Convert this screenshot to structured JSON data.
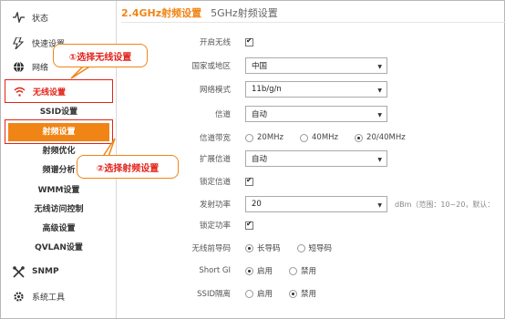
{
  "colors": {
    "accent": "#f08516",
    "highlight": "#e2231a"
  },
  "sidebar": {
    "items": [
      {
        "label": "状态",
        "icon": "pulse-icon"
      },
      {
        "label": "快速设置",
        "icon": "lightning-icon"
      },
      {
        "label": "网络",
        "icon": "globe-icon"
      },
      {
        "label": "无线设置",
        "icon": "wifi-icon",
        "active": true
      }
    ],
    "subitems": [
      {
        "label": "SSID设置"
      },
      {
        "label": "射频设置",
        "active": true
      },
      {
        "label": "射频优化"
      },
      {
        "label": "频谱分析"
      },
      {
        "label": "WMM设置"
      },
      {
        "label": "无线访问控制"
      },
      {
        "label": "高级设置"
      },
      {
        "label": "QVLAN设置"
      }
    ],
    "bottom": [
      {
        "label": "SNMP",
        "icon": "tools-icon"
      },
      {
        "label": "系统工具",
        "icon": "gear-icon"
      }
    ]
  },
  "tabs": [
    {
      "label": "2.4GHz射频设置"
    },
    {
      "label": "5GHz射频设置"
    }
  ],
  "form": {
    "enable_wireless": {
      "label": "开启无线",
      "checked": true
    },
    "country": {
      "label": "国家或地区",
      "value": "中国"
    },
    "network_mode": {
      "label": "网络模式",
      "value": "11b/g/n"
    },
    "channel": {
      "label": "信道",
      "value": "自动"
    },
    "bandwidth": {
      "label": "信道带宽",
      "options": [
        "20MHz",
        "40MHz",
        "20/40MHz"
      ],
      "selected": "20/40MHz"
    },
    "ext_channel": {
      "label": "扩展信道",
      "value": "自动"
    },
    "lock_channel": {
      "label": "锁定信道",
      "checked": true
    },
    "tx_power": {
      "label": "发射功率",
      "value": "20",
      "hint": "dBm（范围：10~20，默认："
    },
    "lock_power": {
      "label": "锁定功率",
      "checked": true
    },
    "preamble": {
      "label": "无线前导码",
      "options": [
        "长导码",
        "短导码"
      ],
      "selected": "长导码"
    },
    "short_gi": {
      "label": "Short GI",
      "options": [
        "启用",
        "禁用"
      ],
      "selected": "启用"
    },
    "ssid_isolation": {
      "label": "SSID隔离",
      "options": [
        "启用",
        "禁用"
      ],
      "selected": "禁用"
    }
  },
  "annotations": {
    "step1": "①选择无线设置",
    "step2": "②选择射频设置"
  }
}
